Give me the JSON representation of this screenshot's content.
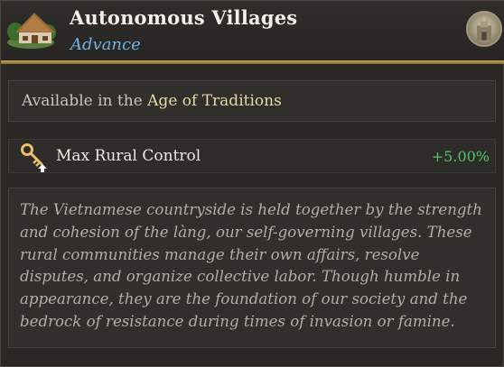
{
  "header": {
    "title": "Autonomous Villages",
    "subtitle": "Advance",
    "icon": "village-house-icon",
    "badge_icon": "age-medallion-icon",
    "accent_color": "#c4a05c"
  },
  "availability": {
    "prefix": "Available in the ",
    "age": "Age of Traditions"
  },
  "effects": [
    {
      "icon": "key-icon",
      "label": "Max Rural Control",
      "value": "+5.00%",
      "value_color": "#4fc66a"
    }
  ],
  "flavor_text": "The Vietnamese countryside is held together by the strength and cohesion of the làng, our self-governing villages. These rural communities manage their own affairs, resolve disputes, and organize collective labor. Though humble in appearance, they are the foundation of our society and the bedrock of resistance during times of invasion or famine."
}
